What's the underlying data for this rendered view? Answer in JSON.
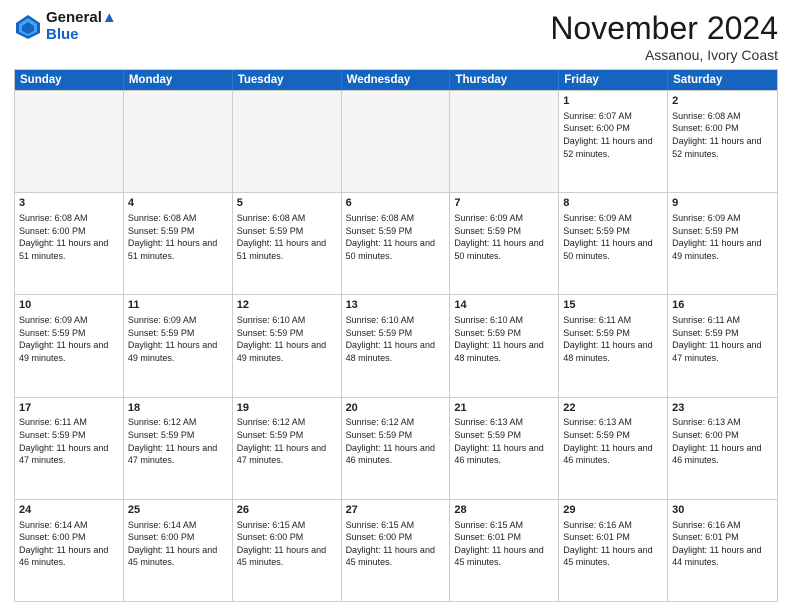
{
  "header": {
    "logo_line1": "General",
    "logo_line2": "Blue",
    "month_title": "November 2024",
    "location": "Assanou, Ivory Coast"
  },
  "days_of_week": [
    "Sunday",
    "Monday",
    "Tuesday",
    "Wednesday",
    "Thursday",
    "Friday",
    "Saturday"
  ],
  "weeks": [
    [
      {
        "day": "",
        "info": ""
      },
      {
        "day": "",
        "info": ""
      },
      {
        "day": "",
        "info": ""
      },
      {
        "day": "",
        "info": ""
      },
      {
        "day": "",
        "info": ""
      },
      {
        "day": "1",
        "info": "Sunrise: 6:07 AM\nSunset: 6:00 PM\nDaylight: 11 hours and 52 minutes."
      },
      {
        "day": "2",
        "info": "Sunrise: 6:08 AM\nSunset: 6:00 PM\nDaylight: 11 hours and 52 minutes."
      }
    ],
    [
      {
        "day": "3",
        "info": "Sunrise: 6:08 AM\nSunset: 6:00 PM\nDaylight: 11 hours and 51 minutes."
      },
      {
        "day": "4",
        "info": "Sunrise: 6:08 AM\nSunset: 5:59 PM\nDaylight: 11 hours and 51 minutes."
      },
      {
        "day": "5",
        "info": "Sunrise: 6:08 AM\nSunset: 5:59 PM\nDaylight: 11 hours and 51 minutes."
      },
      {
        "day": "6",
        "info": "Sunrise: 6:08 AM\nSunset: 5:59 PM\nDaylight: 11 hours and 50 minutes."
      },
      {
        "day": "7",
        "info": "Sunrise: 6:09 AM\nSunset: 5:59 PM\nDaylight: 11 hours and 50 minutes."
      },
      {
        "day": "8",
        "info": "Sunrise: 6:09 AM\nSunset: 5:59 PM\nDaylight: 11 hours and 50 minutes."
      },
      {
        "day": "9",
        "info": "Sunrise: 6:09 AM\nSunset: 5:59 PM\nDaylight: 11 hours and 49 minutes."
      }
    ],
    [
      {
        "day": "10",
        "info": "Sunrise: 6:09 AM\nSunset: 5:59 PM\nDaylight: 11 hours and 49 minutes."
      },
      {
        "day": "11",
        "info": "Sunrise: 6:09 AM\nSunset: 5:59 PM\nDaylight: 11 hours and 49 minutes."
      },
      {
        "day": "12",
        "info": "Sunrise: 6:10 AM\nSunset: 5:59 PM\nDaylight: 11 hours and 49 minutes."
      },
      {
        "day": "13",
        "info": "Sunrise: 6:10 AM\nSunset: 5:59 PM\nDaylight: 11 hours and 48 minutes."
      },
      {
        "day": "14",
        "info": "Sunrise: 6:10 AM\nSunset: 5:59 PM\nDaylight: 11 hours and 48 minutes."
      },
      {
        "day": "15",
        "info": "Sunrise: 6:11 AM\nSunset: 5:59 PM\nDaylight: 11 hours and 48 minutes."
      },
      {
        "day": "16",
        "info": "Sunrise: 6:11 AM\nSunset: 5:59 PM\nDaylight: 11 hours and 47 minutes."
      }
    ],
    [
      {
        "day": "17",
        "info": "Sunrise: 6:11 AM\nSunset: 5:59 PM\nDaylight: 11 hours and 47 minutes."
      },
      {
        "day": "18",
        "info": "Sunrise: 6:12 AM\nSunset: 5:59 PM\nDaylight: 11 hours and 47 minutes."
      },
      {
        "day": "19",
        "info": "Sunrise: 6:12 AM\nSunset: 5:59 PM\nDaylight: 11 hours and 47 minutes."
      },
      {
        "day": "20",
        "info": "Sunrise: 6:12 AM\nSunset: 5:59 PM\nDaylight: 11 hours and 46 minutes."
      },
      {
        "day": "21",
        "info": "Sunrise: 6:13 AM\nSunset: 5:59 PM\nDaylight: 11 hours and 46 minutes."
      },
      {
        "day": "22",
        "info": "Sunrise: 6:13 AM\nSunset: 5:59 PM\nDaylight: 11 hours and 46 minutes."
      },
      {
        "day": "23",
        "info": "Sunrise: 6:13 AM\nSunset: 6:00 PM\nDaylight: 11 hours and 46 minutes."
      }
    ],
    [
      {
        "day": "24",
        "info": "Sunrise: 6:14 AM\nSunset: 6:00 PM\nDaylight: 11 hours and 46 minutes."
      },
      {
        "day": "25",
        "info": "Sunrise: 6:14 AM\nSunset: 6:00 PM\nDaylight: 11 hours and 45 minutes."
      },
      {
        "day": "26",
        "info": "Sunrise: 6:15 AM\nSunset: 6:00 PM\nDaylight: 11 hours and 45 minutes."
      },
      {
        "day": "27",
        "info": "Sunrise: 6:15 AM\nSunset: 6:00 PM\nDaylight: 11 hours and 45 minutes."
      },
      {
        "day": "28",
        "info": "Sunrise: 6:15 AM\nSunset: 6:01 PM\nDaylight: 11 hours and 45 minutes."
      },
      {
        "day": "29",
        "info": "Sunrise: 6:16 AM\nSunset: 6:01 PM\nDaylight: 11 hours and 45 minutes."
      },
      {
        "day": "30",
        "info": "Sunrise: 6:16 AM\nSunset: 6:01 PM\nDaylight: 11 hours and 44 minutes."
      }
    ]
  ]
}
